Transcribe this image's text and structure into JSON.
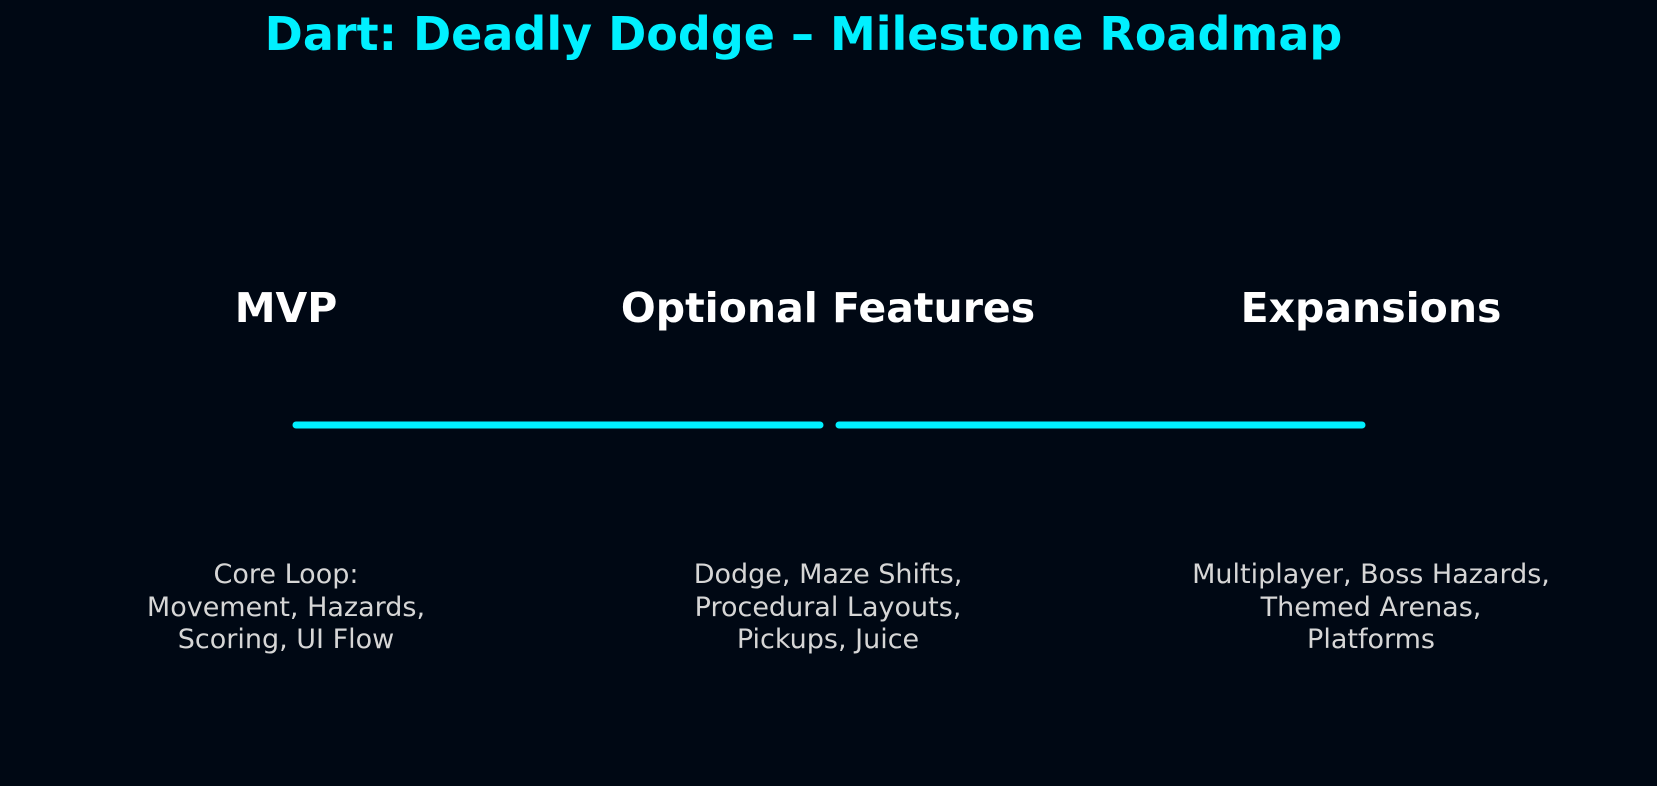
{
  "title": "Dart: Deadly Dodge – Milestone Roadmap",
  "colors": {
    "background": "#000814",
    "accent": "#00f0ff",
    "stage_title": "#ffffff",
    "stage_text": "#d6d6d6"
  },
  "milestones": [
    {
      "name": "MVP",
      "description": "Core Loop:\nMovement, Hazards,\nScoring, UI Flow"
    },
    {
      "name": "Optional Features",
      "description": "Dodge, Maze Shifts,\nProcedural Layouts,\nPickups, Juice"
    },
    {
      "name": "Expansions",
      "description": "Multiplayer, Boss Hazards,\nThemed Arenas,\nPlatforms"
    }
  ],
  "connectors": [
    {
      "from": "MVP",
      "to": "Optional Features"
    },
    {
      "from": "Optional Features",
      "to": "Expansions"
    }
  ]
}
